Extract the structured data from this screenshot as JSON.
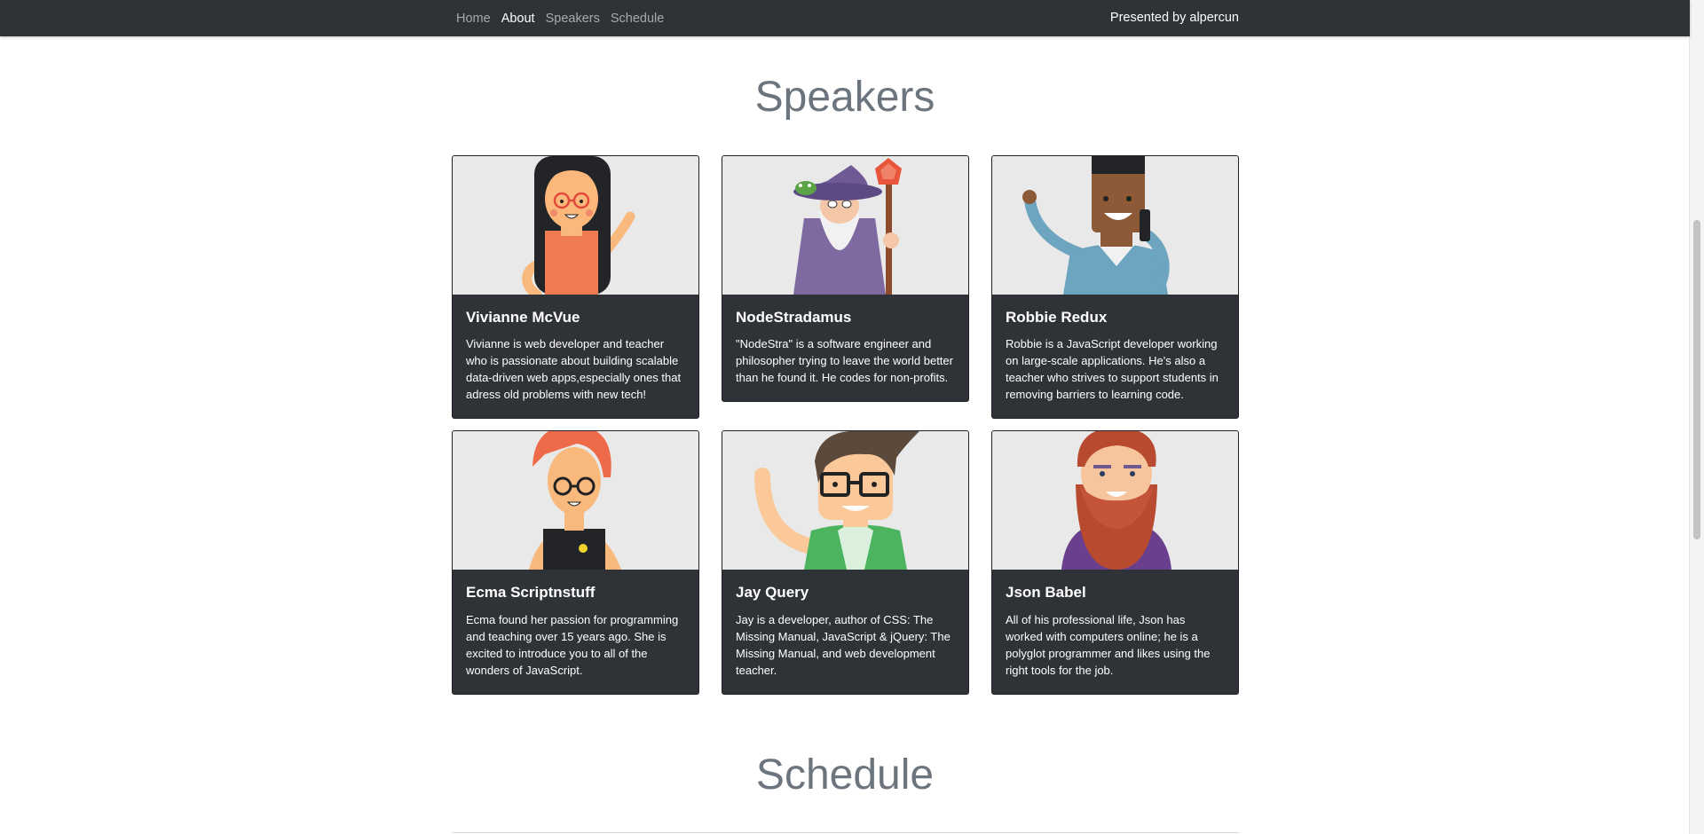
{
  "nav": {
    "links": [
      {
        "label": "Home",
        "active": false
      },
      {
        "label": "About",
        "active": true
      },
      {
        "label": "Speakers",
        "active": false
      },
      {
        "label": "Schedule",
        "active": false
      }
    ],
    "presenter": "Presented by alpercun"
  },
  "sections": {
    "speakers_title": "Speakers",
    "schedule_title": "Schedule"
  },
  "speakers": [
    {
      "name": "Vivianne McVue",
      "bio": "Vivianne is web developer and teacher who is passionate about building scalable data-driven web apps,especially ones that adress old problems with new tech!",
      "avatar": "avatar-long-black-hair-glasses"
    },
    {
      "name": "NodeStradamus",
      "bio": "\"NodeStra\" is a software engineer and philosopher trying to leave the world better than he found it. He codes for non-profits.",
      "avatar": "avatar-wizard"
    },
    {
      "name": "Robbie Redux",
      "bio": "Robbie is a JavaScript developer working on large-scale applications. He's also a teacher who strives to support students in removing barriers to learning code.",
      "avatar": "avatar-waving-phone"
    },
    {
      "name": "Ecma Scriptnstuff",
      "bio": "Ecma found her passion for programming and teaching over 15 years ago. She is excited to introduce you to all of the wonders of JavaScript.",
      "avatar": "avatar-red-hair-glasses"
    },
    {
      "name": "Jay Query",
      "bio": "Jay is a developer, author of CSS: The Missing Manual, JavaScript & jQuery: The Missing Manual, and web development teacher.",
      "avatar": "avatar-glasses-waving"
    },
    {
      "name": "Json Babel",
      "bio": "All of his professional life, Json has worked with computers online; he is a polyglot programmer and likes using the right tools for the job.",
      "avatar": "avatar-red-beard"
    }
  ]
}
